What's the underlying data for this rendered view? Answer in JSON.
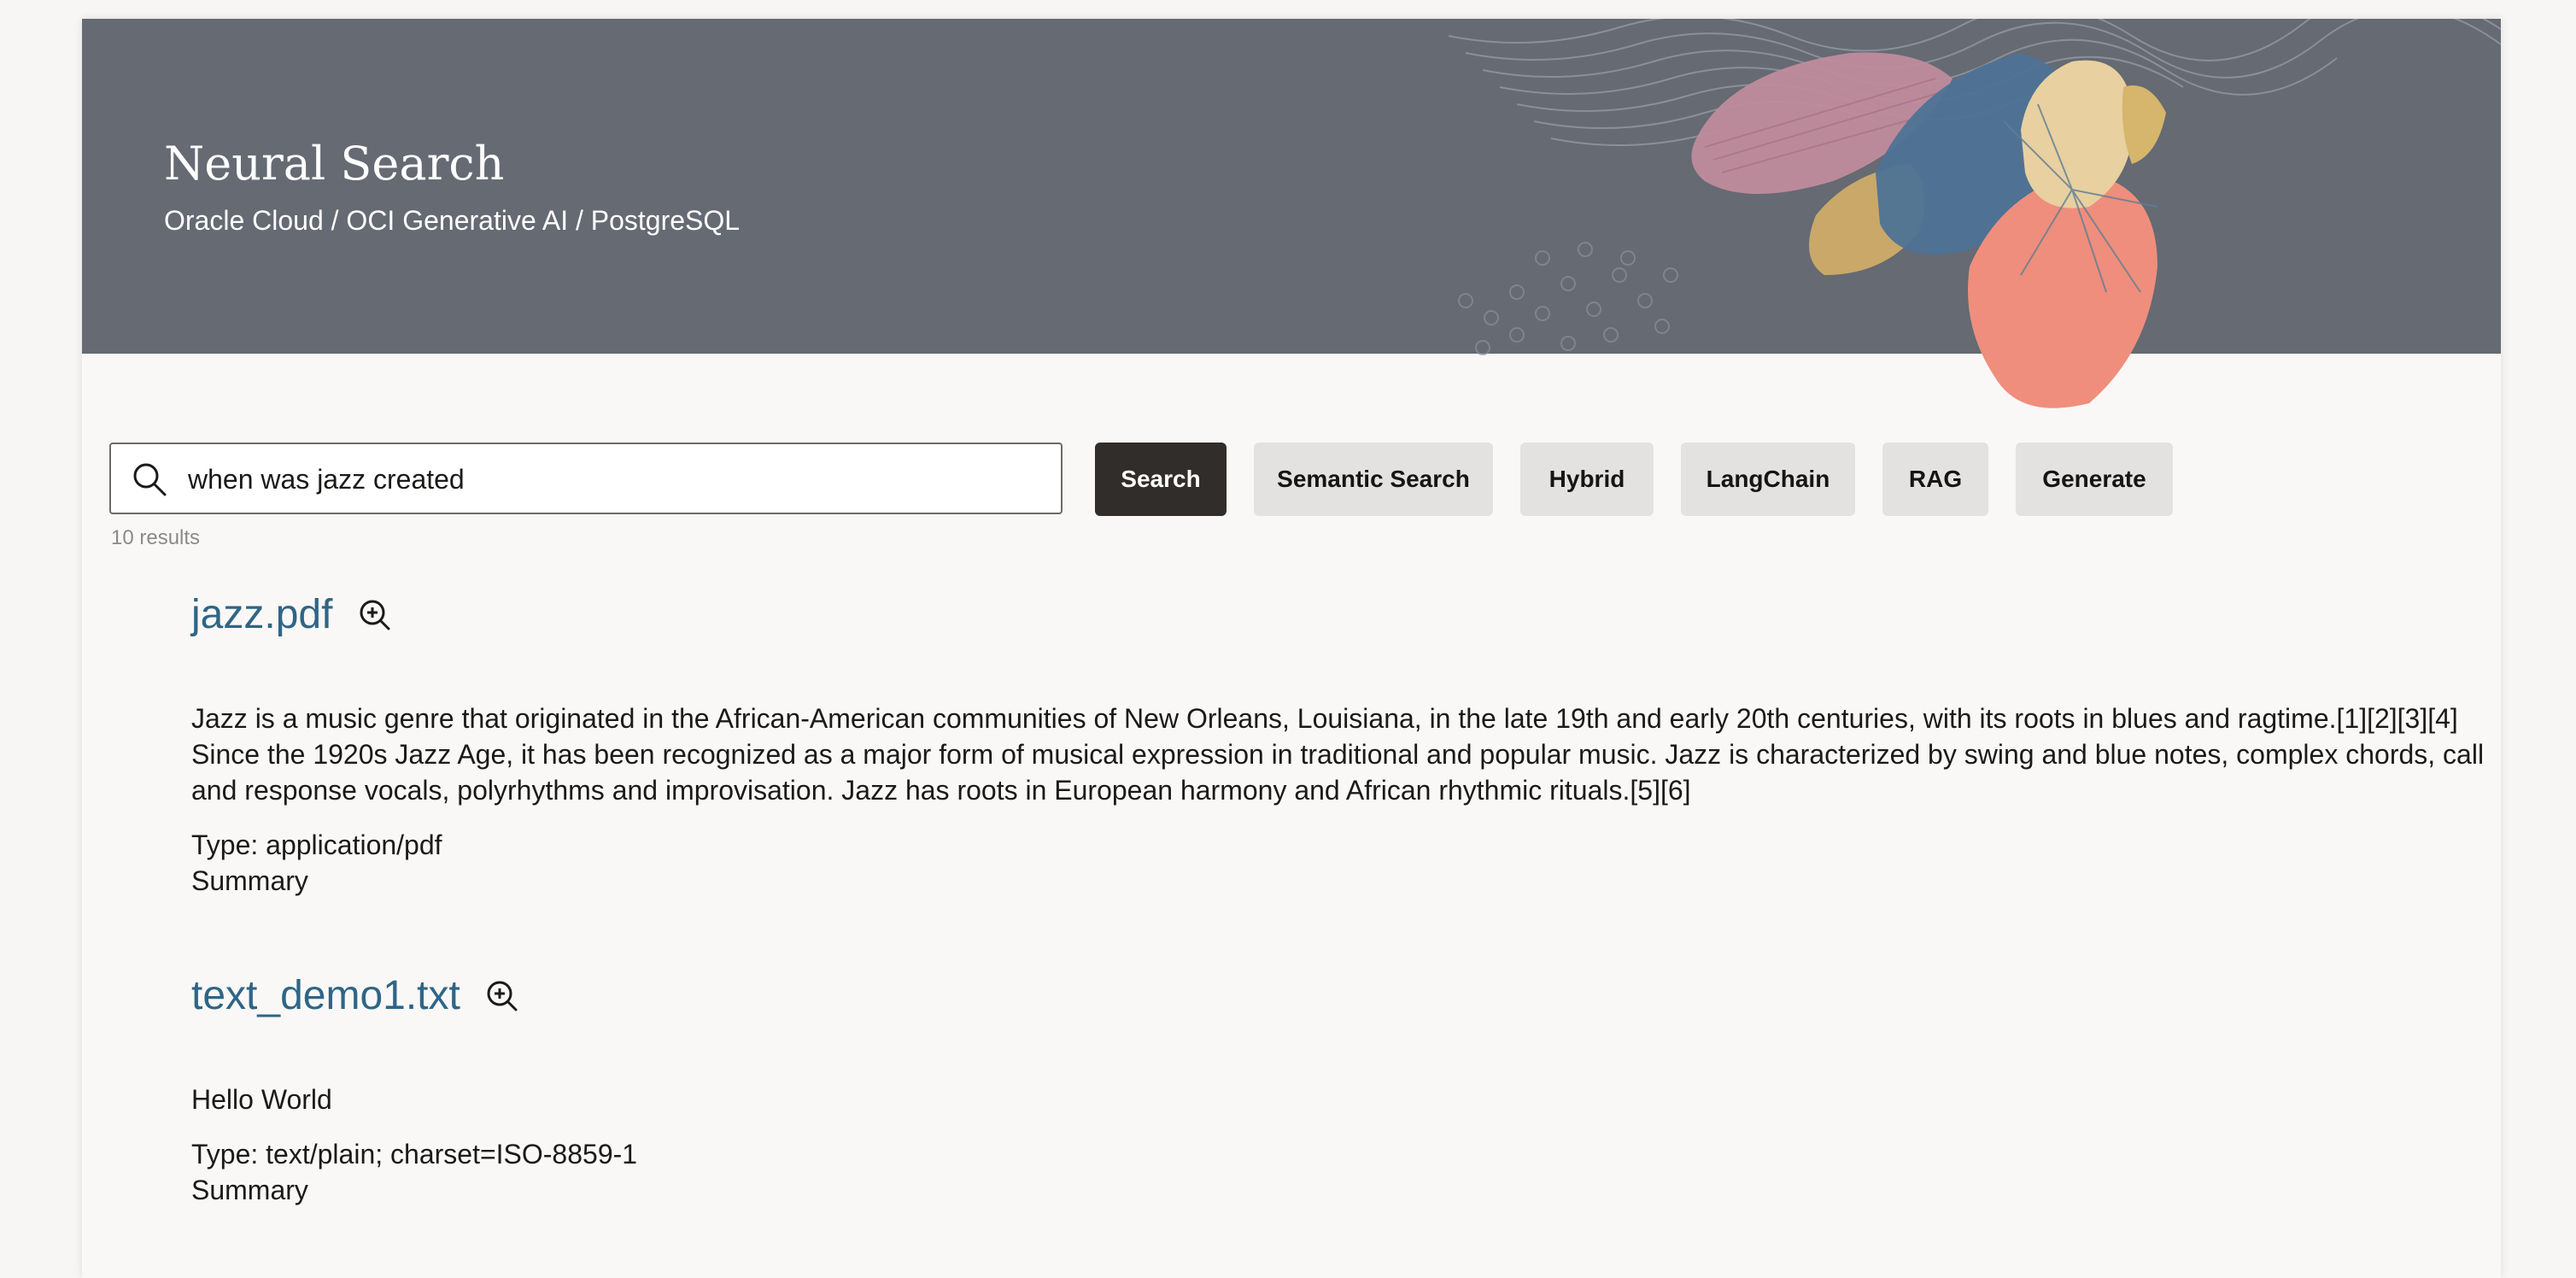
{
  "header": {
    "title": "Neural Search",
    "subtitle": "Oracle Cloud / OCI Generative AI / PostgreSQL"
  },
  "search": {
    "value": "when was jazz created",
    "icon": "search-icon",
    "results_count": "10 results"
  },
  "buttons": {
    "search": "Search",
    "semantic": "Semantic Search",
    "hybrid": "Hybrid",
    "langchain": "LangChain",
    "rag": "RAG",
    "generate": "Generate"
  },
  "results": [
    {
      "title": "jazz.pdf",
      "snippet": "Jazz is a music genre that originated in the African-American communities of New Orleans, Louisiana, in the late 19th and early 20th centuries, with its roots in blues and ragtime.[1][2][3][4] Since the 1920s Jazz Age, it has been recognized as a major form of musical expression in traditional and popular music. Jazz is characterized by swing and blue notes, complex chords, call and response vocals, polyrhythms and improvisation. Jazz has roots in European harmony and African rhythmic rituals.[5][6]",
      "type": "Type: application/pdf",
      "summary": "Summary"
    },
    {
      "title": "text_demo1.txt",
      "snippet": "Hello World",
      "type": "Type: text/plain; charset=ISO-8859-1",
      "summary": "Summary"
    }
  ],
  "colors": {
    "banner": "#656a73",
    "primary_button": "#312d2a",
    "secondary_button": "#e4e2e0",
    "link": "#2f6587"
  }
}
